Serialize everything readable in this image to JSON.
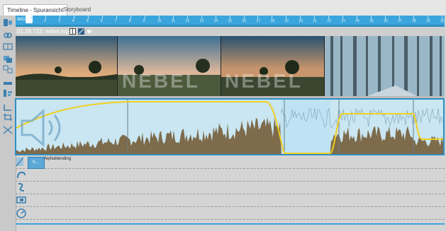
{
  "tabs": [
    {
      "label": "Timeline - Spuransicht",
      "active": true
    },
    {
      "label": "Storyboard",
      "active": false
    }
  ],
  "ruler": {
    "marker_label": "IMG",
    "tick_labels": [
      "1",
      "2",
      "3",
      "4",
      "5",
      "6",
      "7",
      "8",
      "9",
      "10",
      "11",
      "12",
      "13",
      "14",
      "15",
      "16",
      "17",
      "18",
      "19",
      "20",
      "21",
      "22",
      "23",
      "24",
      "25",
      "26",
      "27",
      "28",
      "29",
      "30"
    ]
  },
  "clip": {
    "info": "01:28.723, nebel.mp4"
  },
  "video": {
    "watermark": "NEBEL"
  },
  "effects": {
    "alpha_label": "Alphablending",
    "alpha_value": "0..."
  },
  "tools": [
    "zoom-icon",
    "link-icon",
    "cut-icon",
    "copy-icon",
    "split-icon",
    "group-icon",
    "align-icon",
    "snap-icon",
    "crop-icon"
  ],
  "colors": {
    "accent": "#3aa5dc",
    "selection": "#2f8fc2",
    "volume_line": "#f0d020",
    "waveform": "#7d6b4b"
  }
}
